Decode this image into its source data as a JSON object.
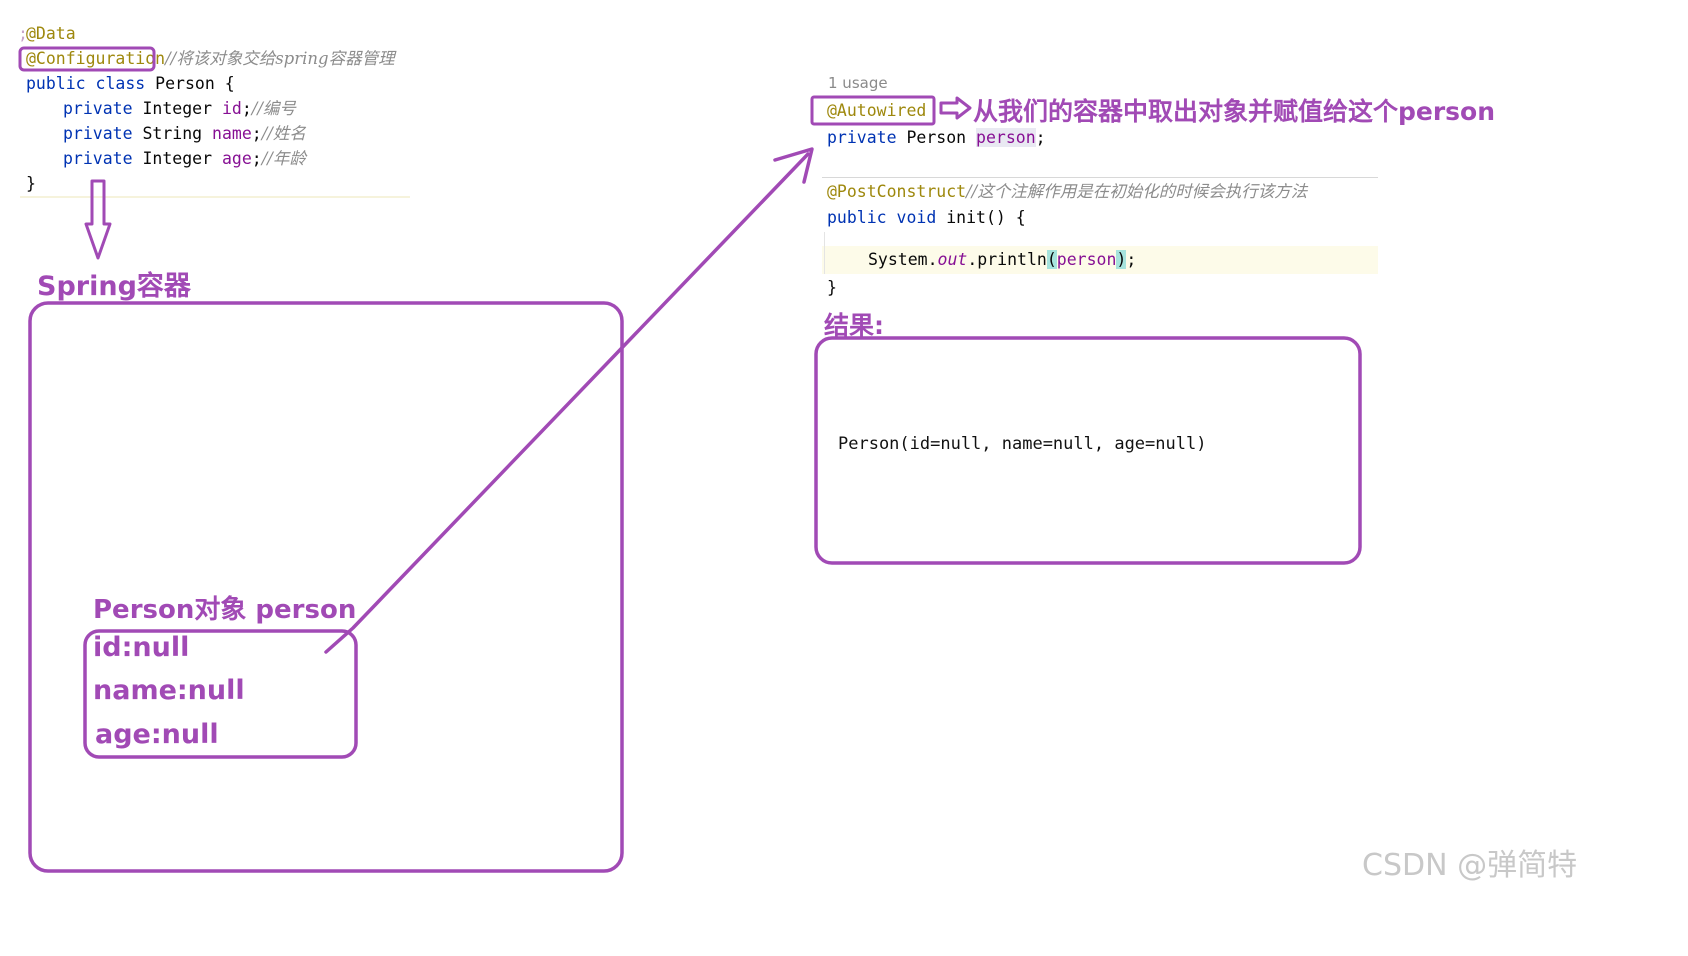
{
  "left_code": {
    "line_data": "@Data",
    "line_config": "@Configuration",
    "line_config_comment": "//将该对象交给spring容器管理",
    "line_class_kw": "public class",
    "line_class_name": " Person {",
    "field1_kw": "private",
    "field1_type": " Integer ",
    "field1_name": "id",
    "field1_semi": ";",
    "field1_comment": "//编号",
    "field2_kw": "private",
    "field2_type": " String ",
    "field2_name": "name",
    "field2_semi": ";",
    "field2_comment": "//姓名",
    "field3_kw": "private",
    "field3_type": " Integer ",
    "field3_name": "age",
    "field3_semi": ";",
    "field3_comment": "//年龄",
    "close_brace": "}"
  },
  "spring_container": {
    "title": "Spring容器",
    "object_title": "Person对象 person",
    "object_fields": [
      "id:null",
      "name:null",
      "age:null"
    ]
  },
  "right_code": {
    "usage": "1 usage",
    "autowired": "@Autowired",
    "autowired_note": "从我们的容器中取出对象并赋值给这个person",
    "field_kw": "private",
    "field_type": " Person ",
    "field_name": "person",
    "field_semi": ";",
    "postconstruct": "@PostConstruct",
    "postconstruct_comment": "//这个注解作用是在初始化的时候会执行该方法",
    "method_kw": "public void",
    "method_name": " init() {",
    "println_prefix": "System.",
    "println_out": "out",
    "println_call": ".println",
    "paren_open": "(",
    "println_arg": "person",
    "paren_close": ")",
    "println_semi": ";",
    "close_brace": "}"
  },
  "result": {
    "title": "结果:",
    "output": "Person(id=null, name=null, age=null)"
  },
  "watermark": "CSDN @弹简特",
  "colors": {
    "purple": "#a14ab5",
    "annotation": "#9e880d",
    "keyword": "#0033b3",
    "field": "#871094"
  }
}
